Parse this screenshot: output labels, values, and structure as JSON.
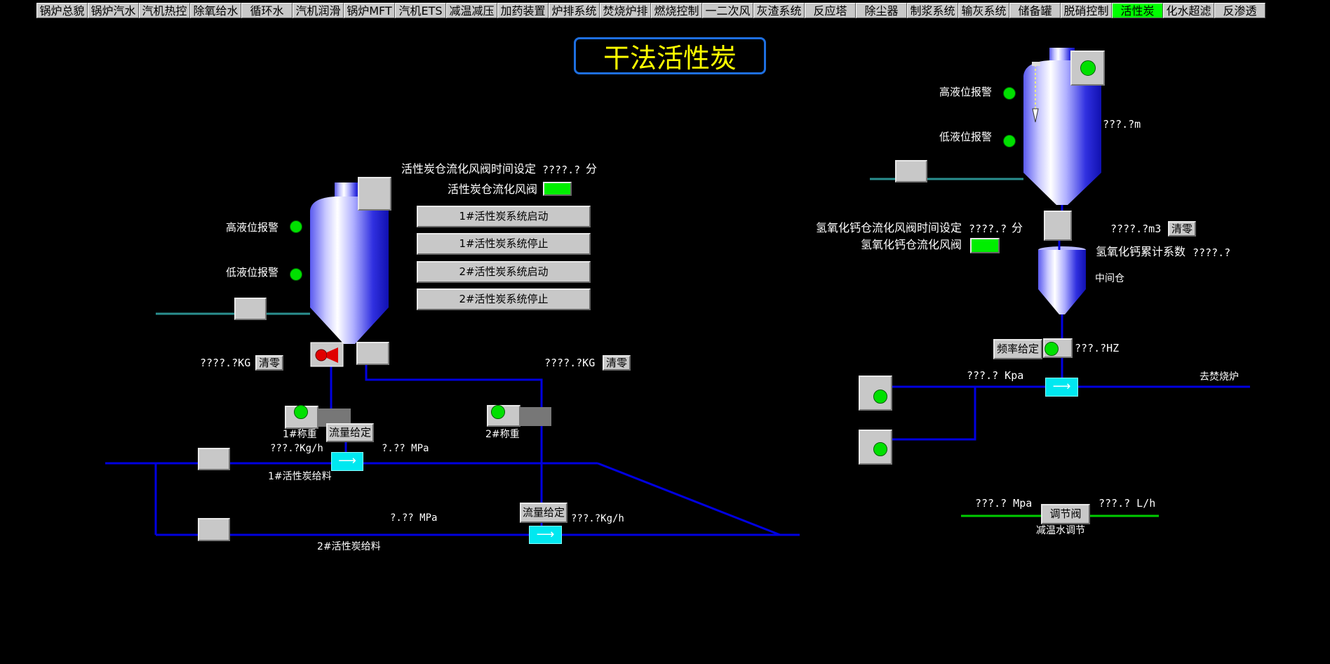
{
  "nav": {
    "tabs": [
      "锅炉总貌",
      "锅炉汽水",
      "汽机热控",
      "除氧给水",
      "循环水",
      "汽机润滑",
      "锅炉MFT",
      "汽机ETS",
      "减温减压",
      "加药装置",
      "炉排系统",
      "焚烧炉排",
      "燃烧控制",
      "一二次风",
      "灰渣系统",
      "反应塔",
      "除尘器",
      "制浆系统",
      "输灰系统",
      "储备罐",
      "脱硝控制",
      "活性炭",
      "化水超滤",
      "反渗透"
    ],
    "active": "活性炭"
  },
  "page_title": "干法活性炭",
  "left": {
    "silo": {
      "high_alarm": "高液位报警",
      "low_alarm": "低液位报警"
    },
    "fluidize_time_label": "活性炭仓流化风阀时间设定",
    "fluidize_time_value": "????.?",
    "fluidize_time_unit": "分",
    "fluidize_valve_label": "活性炭仓流化风阀",
    "buttons": [
      "1#活性炭系统启动",
      "1#活性炭系统停止",
      "2#活性炭系统启动",
      "2#活性炭系统停止"
    ],
    "weigh1": {
      "value": "????.?KG",
      "clear": "清零",
      "label": "1#称重",
      "flow_btn": "流量给定",
      "flow_value": "???.?Kg/h",
      "pressure": "?.??  MPa",
      "feed_label": "1#活性炭给料"
    },
    "weigh2": {
      "value": "????.?KG",
      "clear": "清零",
      "label": "2#称重",
      "flow_btn": "流量给定",
      "flow_value": "???.?Kg/h",
      "pressure": "?.??  MPa",
      "feed_label": "2#活性炭给料"
    }
  },
  "right": {
    "silo": {
      "high_alarm": "高液位报警",
      "low_alarm": "低液位报警",
      "level": "???.?m"
    },
    "fluidize_time_label": "氢氧化钙仓流化风阀时间设定",
    "fluidize_time_value": "????.?",
    "fluidize_time_unit": "分",
    "fluidize_valve_label": "氢氧化钙仓流化风阀",
    "volume": "????.?m3",
    "clear": "清零",
    "coef_label": "氢氧化钙累计系数",
    "coef_value": "????.?",
    "mid_bin": "中间仓",
    "freq_btn": "频率给定",
    "freq_value": "???.?HZ",
    "pressure": "???.? Kpa",
    "to_furnace": "去焚烧炉",
    "water": {
      "pressure": "???.? Mpa",
      "valve_btn": "调节阀",
      "flow": "???.? L/h",
      "label": "减温水调节"
    }
  },
  "colors": {
    "pipe_blue": "#0000e0",
    "pipe_teal": "#2a8f8f",
    "pipe_green": "#00cc00",
    "active_tab": "#00ff00",
    "title": "#ffff00"
  }
}
